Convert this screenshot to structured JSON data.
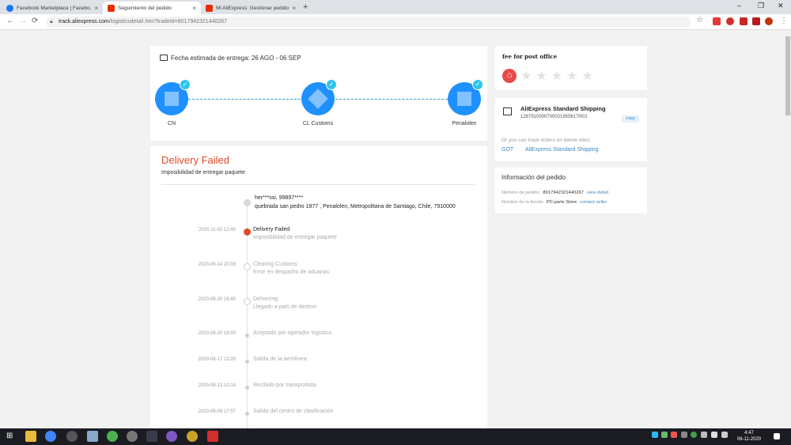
{
  "browser": {
    "tabs": [
      {
        "label": "Facebook Marketplace | Facebo...",
        "color": "#1877f2"
      },
      {
        "label": "Seguimiento del pedido",
        "color": "#e62e04"
      },
      {
        "label": "Mi AliExpress: Gestionar pedidos",
        "color": "#e62e04"
      }
    ],
    "tab_close": "×",
    "new_tab": "+",
    "win_min": "–",
    "win_max": "❐",
    "win_close": "✕",
    "back": "←",
    "forward": "→",
    "reload": "⟳",
    "url_host": "track.aliexpress.com",
    "url_path": "/logisticsdetail.htm?tradeId=8017942321440267",
    "star": "☆",
    "menu": "⋮"
  },
  "eta": {
    "title": "Fecha estimada de entrega: 26 AGO - 06 SEP",
    "nodes": [
      {
        "label": "CN"
      },
      {
        "label": "CL Customs"
      },
      {
        "label": "Penalolen"
      }
    ],
    "check": "✓"
  },
  "detail": {
    "status_title": "Delivery Failed",
    "status_subtitle": "Imposibilidad de entregar paquete",
    "address_name": "her***ssi,  99897****",
    "address_line": "quebrada san pedro 1877 ,  Penalolen,  Metropolitana de Santiago,  Chile,  7910000",
    "events": [
      {
        "date": "2020-11-02 12:40",
        "status": "Delivery Failed",
        "desc": "Imposibilidad de entregar paquete"
      },
      {
        "date": "2020-09-14 20:08",
        "status": "Clearing Customs",
        "desc": "Error en despacho de aduanas"
      },
      {
        "date": "2020-08-20 16:40",
        "status": "Delivering",
        "desc": "Llegado a país de destino"
      },
      {
        "date": "2020-08-20 16:00",
        "status": "Aceptado por operador logístico",
        "desc": ""
      },
      {
        "date": "2020-08-17 22:00",
        "status": "Salida de la aerolínea",
        "desc": ""
      },
      {
        "date": "2020-08-13 10:14",
        "status": "Recibido por transportista",
        "desc": ""
      },
      {
        "date": "2020-08-09 17:57",
        "status": "Salida del centro de clasificación",
        "desc": ""
      }
    ]
  },
  "rating": {
    "title": "fee for post office",
    "home_icon": "⌂",
    "stars": "★★★★★",
    "score": 0
  },
  "shipping": {
    "carrier": "AliExpress Standard Shipping",
    "tracking": "1287910000700021955617l001",
    "copy": "copy",
    "note": "Or you can track orders on below sites:",
    "link1": "GOT",
    "link2": "AliExpress Standard Shipping"
  },
  "order": {
    "title": "Información del pedido",
    "number_label": "Número de pedido:",
    "number": "8017942321440267",
    "view_detail": "view detail",
    "store_label": "Nombre de la tienda:",
    "store": "PC-parts Store",
    "contact": "contact seller"
  },
  "taskbar": {
    "time": "4:47",
    "date": "06-11-2020",
    "start": "⊞"
  }
}
